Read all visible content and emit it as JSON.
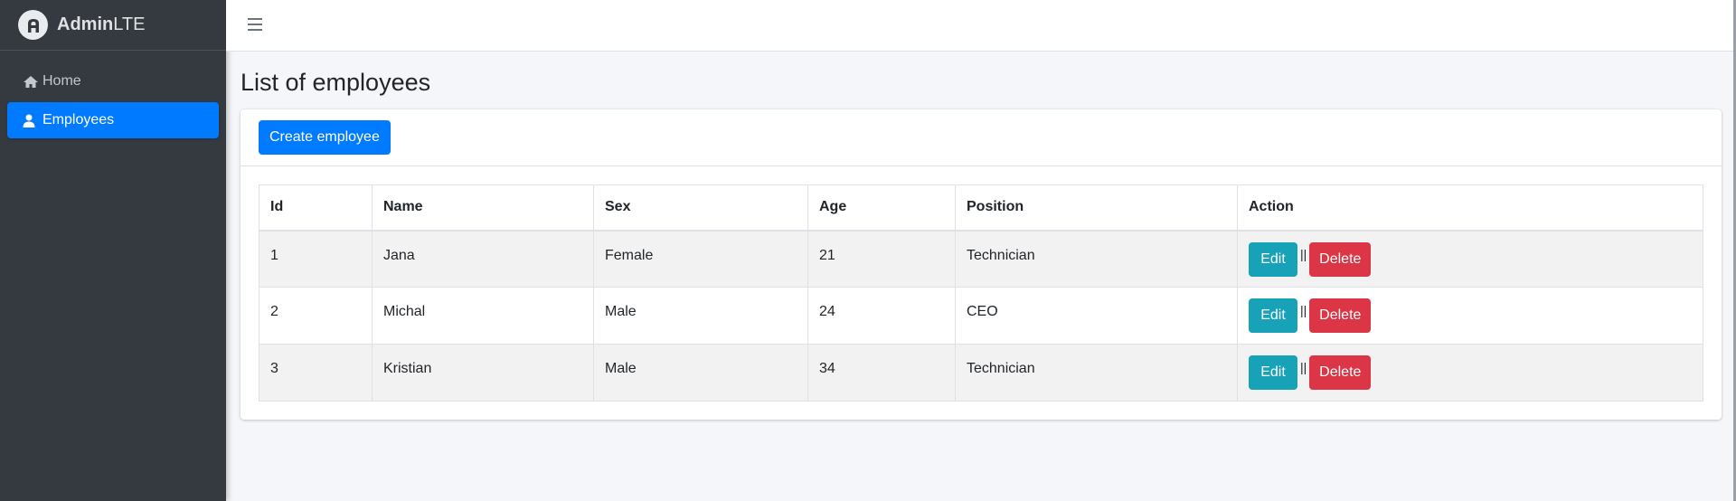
{
  "brand": {
    "bold": "Admin",
    "light": "LTE",
    "logo_icon": "adminlte-logo-icon"
  },
  "sidebar": {
    "items": [
      {
        "label": "Home",
        "icon": "home-icon",
        "active": false
      },
      {
        "label": "Employees",
        "icon": "user-icon",
        "active": true
      }
    ]
  },
  "topbar": {
    "menu_icon": "hamburger-icon"
  },
  "page": {
    "title": "List of employees"
  },
  "card": {
    "create_label": "Create employee"
  },
  "table": {
    "columns": [
      "Id",
      "Name",
      "Sex",
      "Age",
      "Position",
      "Action"
    ],
    "rows": [
      {
        "id": "1",
        "name": "Jana",
        "sex": "Female",
        "age": "21",
        "position": "Technician"
      },
      {
        "id": "2",
        "name": "Michal",
        "sex": "Male",
        "age": "24",
        "position": "CEO"
      },
      {
        "id": "3",
        "name": "Kristian",
        "sex": "Male",
        "age": "34",
        "position": "Technician"
      }
    ],
    "edit_label": "Edit",
    "delete_label": "Delete",
    "separator": "||"
  },
  "colors": {
    "sidebar_bg": "#343a40",
    "primary": "#007bff",
    "info": "#17a2b8",
    "danger": "#dc3545",
    "page_bg": "#f4f6f9"
  }
}
